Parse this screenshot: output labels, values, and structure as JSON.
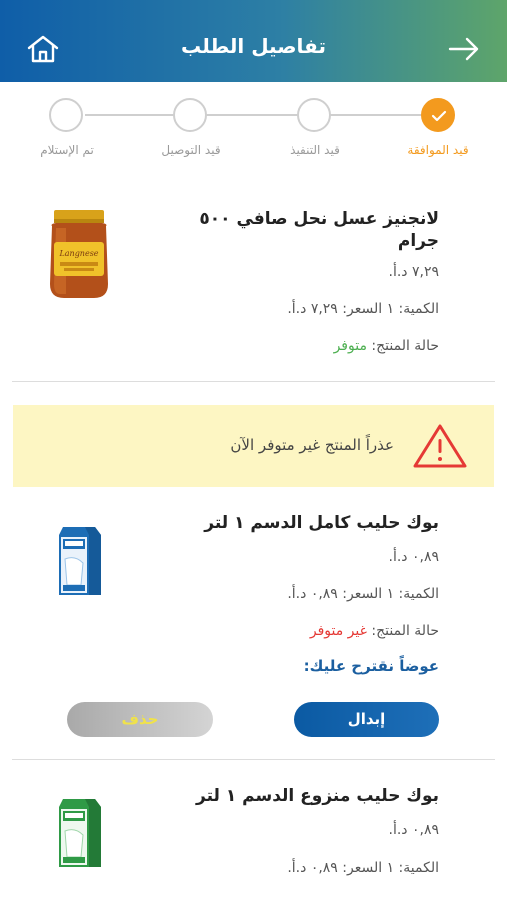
{
  "header": {
    "title": "تفاصيل الطلب"
  },
  "stepper": {
    "steps": [
      {
        "label": "قيد الموافقة",
        "state": "done"
      },
      {
        "label": "قيد التنفيذ",
        "state": "pending"
      },
      {
        "label": "قيد التوصيل",
        "state": "pending"
      },
      {
        "label": "تم الإستلام",
        "state": "pending"
      }
    ]
  },
  "products": [
    {
      "name": "لانجنيز عسل نحل صافي ٥٠٠ جرام",
      "price": "٧,٢٩ د.أ.",
      "qty_price": "الكمية: ١   السعر: ٧,٢٩ د.أ.",
      "status_label": "حالة المنتج: ",
      "status_value": "متوفر"
    },
    {
      "name": "بوك حليب كامل الدسم ١ لتر",
      "price": "٠,٨٩ د.أ.",
      "qty_price": "الكمية: ١   السعر: ٠,٨٩ د.أ.",
      "status_label": "حالة المنتج: ",
      "status_value": "غير متوفر"
    },
    {
      "name": "بوك حليب منزوع الدسم ١ لتر",
      "price": "٠,٨٩ د.أ.",
      "qty_price": "الكمية: ١   السعر: ٠,٨٩ د.أ."
    }
  ],
  "warning": {
    "text": "عذراً المنتج غير متوفر الآن"
  },
  "suggest_label": "عوضاً نقترح عليك:",
  "actions": {
    "replace_label": "إبدال",
    "delete_label": "حذف"
  },
  "colors": {
    "accent": "#f39a1e",
    "primary": "#0b5aa3",
    "available": "#4caf50",
    "unavailable": "#e53935"
  }
}
